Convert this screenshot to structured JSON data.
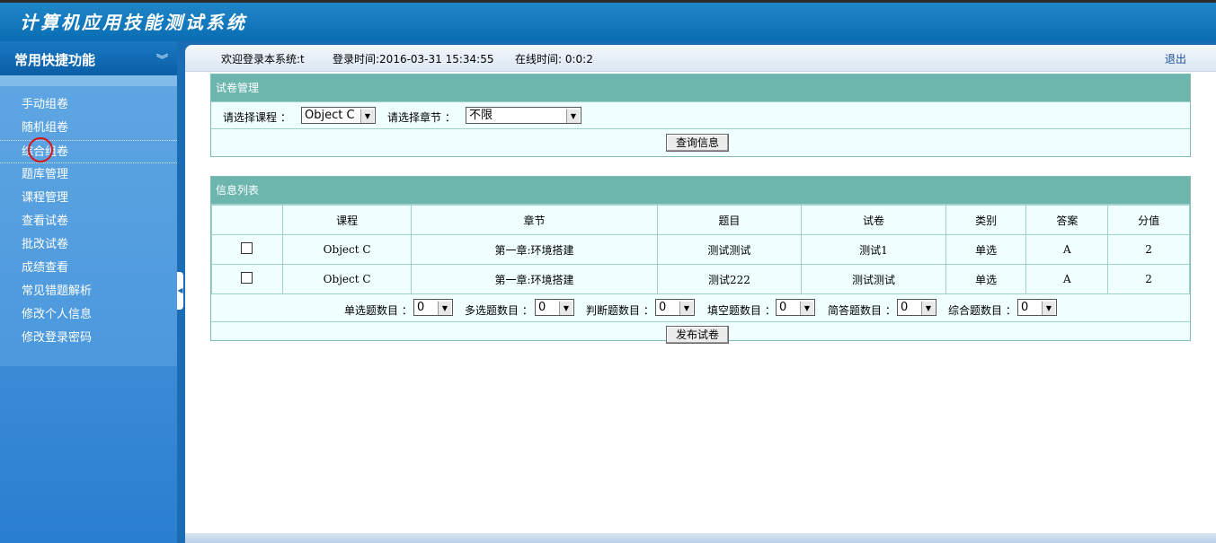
{
  "app": {
    "title": "计算机应用技能测试系统"
  },
  "sidebar": {
    "heading": "常用快捷功能",
    "items": [
      {
        "label": "手动组卷"
      },
      {
        "label": "随机组卷"
      },
      {
        "label": "综合组卷"
      },
      {
        "label": "题库管理"
      },
      {
        "label": "课程管理"
      },
      {
        "label": "查看试卷"
      },
      {
        "label": "批改试卷"
      },
      {
        "label": "成绩查看"
      },
      {
        "label": "常见错题解析"
      },
      {
        "label": "修改个人信息"
      },
      {
        "label": "修改登录密码"
      }
    ]
  },
  "topbar": {
    "welcome": "欢迎登录本系统:t",
    "login_time": "登录时间:2016-03-31 15:34:55",
    "online_time": "在线时间: 0:0:2",
    "logout": "退出"
  },
  "exam_panel": {
    "title": "试卷管理",
    "course_label": "请选择课程 ：",
    "course_value": "Object C",
    "chapter_label": "请选择章节 ：",
    "chapter_value": "不限",
    "query_button": "查询信息"
  },
  "list_panel": {
    "title": "信息列表",
    "columns": [
      "",
      "课程",
      "章节",
      "题目",
      "试卷",
      "类别",
      "答案",
      "分值"
    ],
    "rows": [
      [
        "",
        "Object C",
        "第一章:环境搭建",
        "测试测试",
        "测试1",
        "单选",
        "A",
        "2"
      ],
      [
        "",
        "Object C",
        "第一章:环境搭建",
        "测试222",
        "测试测试",
        "单选",
        "A",
        "2"
      ]
    ],
    "counts": [
      {
        "label": "单选题数目 ：",
        "value": "0"
      },
      {
        "label": "多选题数目 ：",
        "value": "0"
      },
      {
        "label": "判断题数目 ：",
        "value": "0"
      },
      {
        "label": "填空题数目 ：",
        "value": "0"
      },
      {
        "label": "简答题数目 ：",
        "value": "0"
      },
      {
        "label": "综合题数目 ：",
        "value": "0"
      }
    ],
    "publish_button": "发布试卷"
  }
}
